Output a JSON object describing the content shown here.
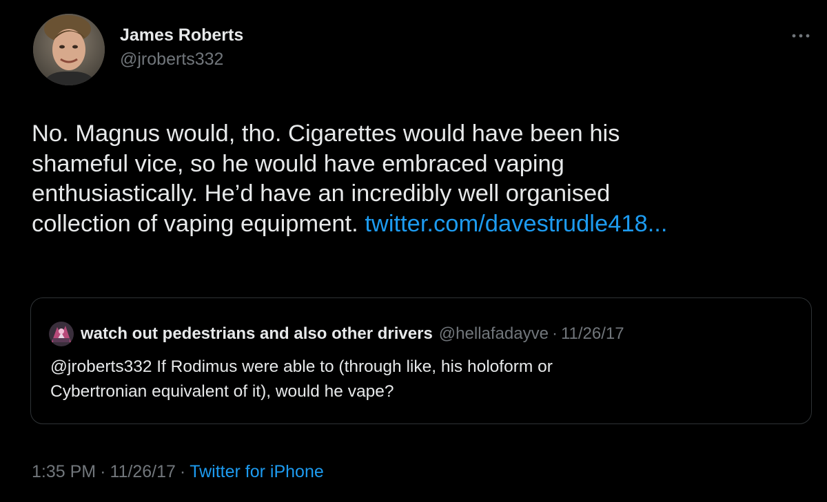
{
  "tweet": {
    "author": {
      "display_name": "James Roberts",
      "handle": "@jroberts332",
      "avatar_icon": "user-photo-avatar"
    },
    "body": {
      "lines": [
        "No. Magnus would, tho. Cigarettes would have been his",
        "shameful vice, so he would have embraced vaping",
        "enthusiastically. He’d have an incredibly well organised"
      ],
      "last_line_text": "collection of vaping equipment.",
      "link": "twitter.com/davestrudle418..."
    },
    "quoted_tweet": {
      "display_name": "watch out pedestrians and also other drivers",
      "handle": "@hellafadayve",
      "separator": "·",
      "date": "11/26/17",
      "text_lines": [
        "@jroberts332 If Rodimus were able to (through like, his holoform or",
        "Cybertronian equivalent of it), would he vape?"
      ]
    },
    "meta": {
      "time": "1:35 PM",
      "separator": "·",
      "date": "11/26/17",
      "source": "Twitter for iPhone"
    },
    "more_icon": "more-horizontal-icon"
  },
  "colors": {
    "background": "#000000",
    "text_primary": "#e7e9ea",
    "text_secondary": "#71767b",
    "link": "#1d9bf0",
    "border": "#2f3336"
  }
}
